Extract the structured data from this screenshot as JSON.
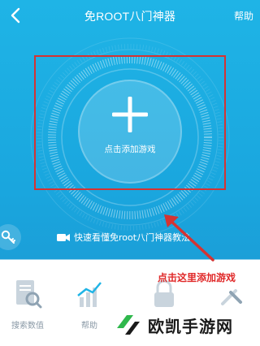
{
  "header": {
    "title": "免ROOT八门神器",
    "help_label": "帮助"
  },
  "main": {
    "add_game_label": "点击添加游戏",
    "video_tip": "快速看懂免root八门神器教法"
  },
  "annotation": {
    "text": "点击这里添加游戏",
    "color": "#e02828"
  },
  "tools": [
    {
      "label": "搜索数值",
      "icon": "search-document-icon"
    },
    {
      "label": "帮助",
      "icon": "chart-icon"
    },
    {
      "label": "",
      "icon": "lock-icon"
    },
    {
      "label": "",
      "icon": "tools-icon"
    }
  ],
  "watermark": {
    "text": "欧凯手游网"
  },
  "colors": {
    "accent": "#1fb4e6",
    "annotation_red": "#d43333"
  }
}
